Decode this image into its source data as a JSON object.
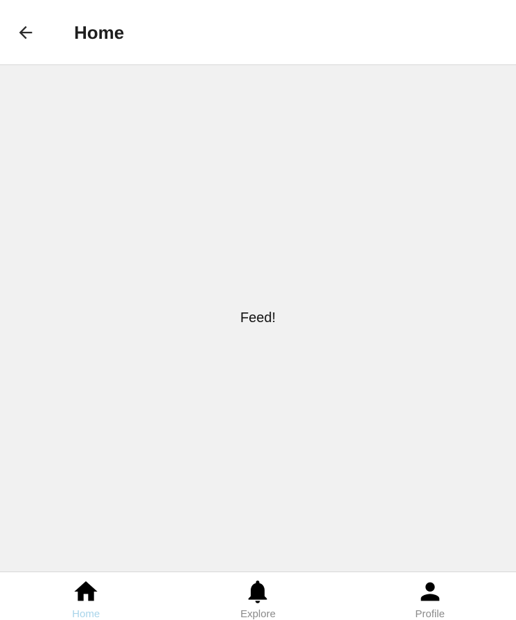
{
  "header": {
    "title": "Home",
    "back_icon": "arrow-left-icon"
  },
  "main": {
    "message": "Feed!"
  },
  "tabbar": {
    "tabs": [
      {
        "label": "Home",
        "icon": "home-icon",
        "active": true,
        "color": "#a8d4ea"
      },
      {
        "label": "Explore",
        "icon": "bell-icon",
        "active": false,
        "color": "#8a8a8a"
      },
      {
        "label": "Profile",
        "icon": "person-icon",
        "active": false,
        "color": "#8a8a8a"
      }
    ]
  },
  "colors": {
    "header_bg": "#ffffff",
    "content_bg": "#f1f1f1",
    "active_tab": "#a8d4ea",
    "inactive_tab": "#8a8a8a"
  }
}
